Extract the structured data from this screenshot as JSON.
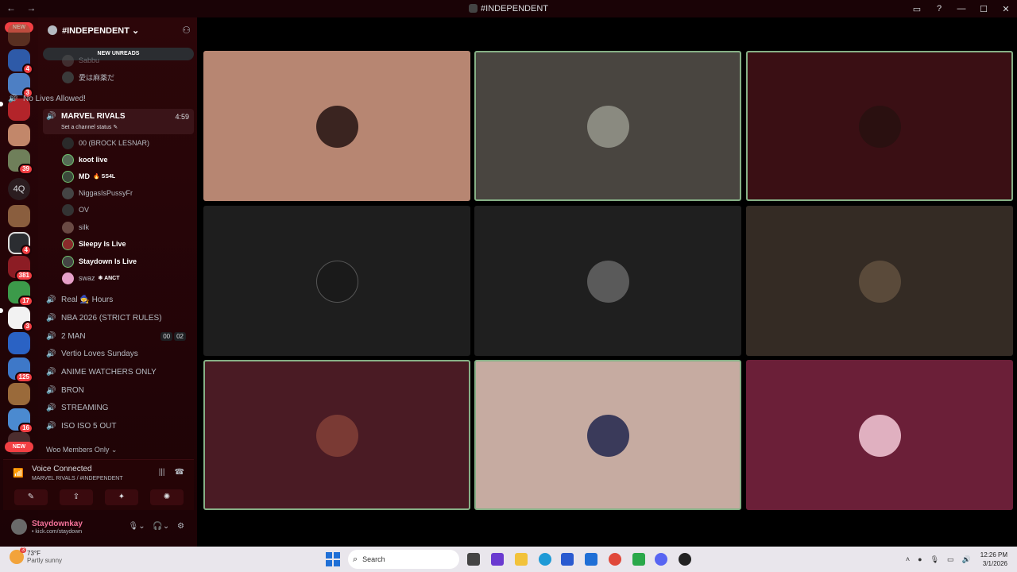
{
  "window": {
    "back": "←",
    "forward": "→",
    "title": "#INDEPENDENT",
    "controls": [
      "▭",
      "?",
      "—",
      "☐",
      "✕"
    ]
  },
  "server": {
    "name": "#INDEPENDENT ⌄",
    "new_unreads": "NEW UNREADS",
    "category": "Woo Members Only ⌄"
  },
  "guild_badges": {
    "g1": "4",
    "g2": "3",
    "g3": "39",
    "g4": "4",
    "g5": "381",
    "g6": "17",
    "g7": "3",
    "g8": "125",
    "g9": "16",
    "txt": "4Q",
    "new_top": "NEW",
    "new_bottom": "NEW"
  },
  "channels": {
    "no_lives": "No Lives Allowed!",
    "marvel": "MARVEL RIVALS",
    "marvel_time": "4:59",
    "marvel_status": "Set a channel status ✎",
    "real_hours": "Real 🧙 Hours",
    "nba": "NBA 2026 (STRICT RULES)",
    "two_man": "2 MAN",
    "two_man_a": "00",
    "two_man_b": "02",
    "vertio": "Vertio Loves Sundays",
    "anime": "ANIME WATCHERS ONLY",
    "bron": "BRON",
    "streaming": "STREAMING",
    "iso": "ISO ISO 5 OUT"
  },
  "top_members": [
    "Sabbu",
    "愛は麻薬だ"
  ],
  "members": [
    {
      "name": "00 (BROCK LESNAR)",
      "tag": ""
    },
    {
      "name": "koot live",
      "tag": ""
    },
    {
      "name": "MD",
      "tag": "🔥 SS4L"
    },
    {
      "name": "NiggasIsPussyFr",
      "tag": ""
    },
    {
      "name": "OV",
      "tag": ""
    },
    {
      "name": "silk",
      "tag": ""
    },
    {
      "name": "Sleepy Is Live",
      "tag": ""
    },
    {
      "name": "Staydown Is Live",
      "tag": ""
    },
    {
      "name": "swaz",
      "tag": "❄ ANCT"
    }
  ],
  "voice": {
    "status": "Voice Connected",
    "location": "MARVEL RIVALS / #INDEPENDENT",
    "buttons": [
      "✎",
      "⇪",
      "✦",
      "✺"
    ]
  },
  "user": {
    "name": "Staydownkay",
    "status": "• kick.com/staydown"
  },
  "tile_colors": [
    "#b78672",
    "#494540",
    "#3a0f14",
    "#1e1e1e",
    "#1f1f1f",
    "#342b24",
    "#4a1b24",
    "#c6aba1",
    "#6b1f38"
  ],
  "taskbar": {
    "weather_badge": "3",
    "temperature": "73°F",
    "condition": "Partly sunny",
    "search": "Search",
    "time": "12:26 PM",
    "date": "3/1/2026"
  }
}
